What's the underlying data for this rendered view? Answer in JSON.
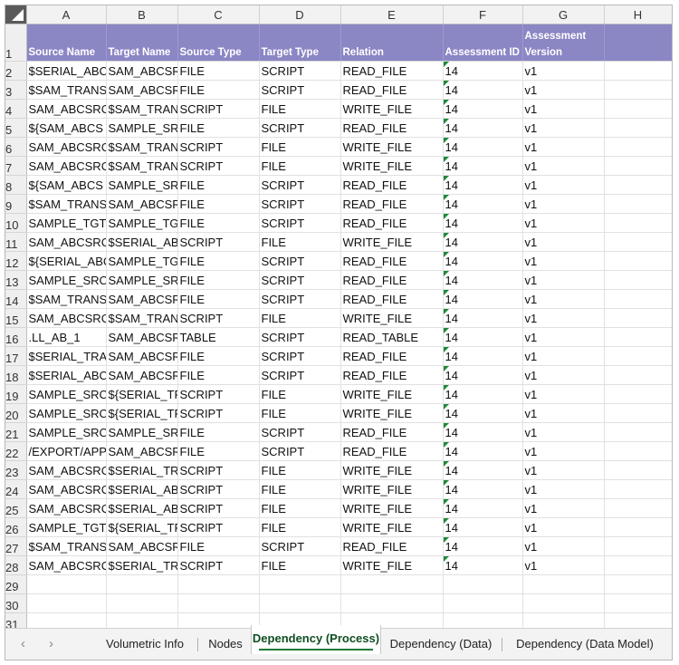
{
  "columns": [
    "A",
    "B",
    "C",
    "D",
    "E",
    "F",
    "G",
    "H"
  ],
  "header_row": {
    "number": "1",
    "cells": [
      "Source Name",
      "Target Name",
      "Source Type",
      "Target Type",
      "Relation",
      "Assessment ID",
      "Assessment Version",
      ""
    ]
  },
  "rows": [
    {
      "n": "2",
      "cells": [
        "$SERIAL_ABC",
        "SAM_ABCSR",
        "FILE",
        "SCRIPT",
        "READ_FILE",
        "14",
        "v1"
      ]
    },
    {
      "n": "3",
      "cells": [
        "$SAM_TRANS",
        "SAM_ABCSR",
        "FILE",
        "SCRIPT",
        "READ_FILE",
        "14",
        "v1"
      ]
    },
    {
      "n": "4",
      "cells": [
        "SAM_ABCSRC",
        "$SAM_TRAN",
        "SCRIPT",
        "FILE",
        "WRITE_FILE",
        "14",
        "v1"
      ]
    },
    {
      "n": "5",
      "cells": [
        "${SAM_ABCS",
        "SAMPLE_SR",
        "FILE",
        "SCRIPT",
        "READ_FILE",
        "14",
        "v1"
      ]
    },
    {
      "n": "6",
      "cells": [
        "SAM_ABCSRC",
        "$SAM_TRAN",
        "SCRIPT",
        "FILE",
        "WRITE_FILE",
        "14",
        "v1"
      ]
    },
    {
      "n": "7",
      "cells": [
        "SAM_ABCSRC",
        "$SAM_TRAN",
        "SCRIPT",
        "FILE",
        "WRITE_FILE",
        "14",
        "v1"
      ]
    },
    {
      "n": "8",
      "cells": [
        "${SAM_ABCS",
        "SAMPLE_SR",
        "FILE",
        "SCRIPT",
        "READ_FILE",
        "14",
        "v1"
      ]
    },
    {
      "n": "9",
      "cells": [
        "$SAM_TRANS",
        "SAM_ABCSR",
        "FILE",
        "SCRIPT",
        "READ_FILE",
        "14",
        "v1"
      ]
    },
    {
      "n": "10",
      "cells": [
        "SAMPLE_TGT_",
        "SAMPLE_TG",
        "FILE",
        "SCRIPT",
        "READ_FILE",
        "14",
        "v1"
      ]
    },
    {
      "n": "11",
      "cells": [
        "SAM_ABCSRC",
        "$SERIAL_AB",
        "SCRIPT",
        "FILE",
        "WRITE_FILE",
        "14",
        "v1"
      ]
    },
    {
      "n": "12",
      "cells": [
        "${SERIAL_ABC",
        "SAMPLE_TG",
        "FILE",
        "SCRIPT",
        "READ_FILE",
        "14",
        "v1"
      ]
    },
    {
      "n": "13",
      "cells": [
        "SAMPLE_SRC",
        "SAMPLE_SR",
        "FILE",
        "SCRIPT",
        "READ_FILE",
        "14",
        "v1"
      ]
    },
    {
      "n": "14",
      "cells": [
        "$SAM_TRANS",
        "SAM_ABCSR",
        "FILE",
        "SCRIPT",
        "READ_FILE",
        "14",
        "v1"
      ]
    },
    {
      "n": "15",
      "cells": [
        "SAM_ABCSRC",
        "$SAM_TRAN",
        "SCRIPT",
        "FILE",
        "WRITE_FILE",
        "14",
        "v1"
      ]
    },
    {
      "n": "16",
      "cells": [
        ".LL_AB_1",
        "SAM_ABCSR",
        "TABLE",
        "SCRIPT",
        "READ_TABLE",
        "14",
        "v1"
      ]
    },
    {
      "n": "17",
      "cells": [
        "$SERIAL_TRA",
        "SAM_ABCSR",
        "FILE",
        "SCRIPT",
        "READ_FILE",
        "14",
        "v1"
      ]
    },
    {
      "n": "18",
      "cells": [
        "$SERIAL_ABC",
        "SAM_ABCSR",
        "FILE",
        "SCRIPT",
        "READ_FILE",
        "14",
        "v1"
      ]
    },
    {
      "n": "19",
      "cells": [
        "SAMPLE_SRC",
        "${SERIAL_TR",
        "SCRIPT",
        "FILE",
        "WRITE_FILE",
        "14",
        "v1"
      ]
    },
    {
      "n": "20",
      "cells": [
        "SAMPLE_SRC",
        "${SERIAL_TR",
        "SCRIPT",
        "FILE",
        "WRITE_FILE",
        "14",
        "v1"
      ]
    },
    {
      "n": "21",
      "cells": [
        "SAMPLE_SRC",
        "SAMPLE_SR",
        "FILE",
        "SCRIPT",
        "READ_FILE",
        "14",
        "v1"
      ]
    },
    {
      "n": "22",
      "cells": [
        "/EXPORT/APP",
        "SAM_ABCSR",
        "FILE",
        "SCRIPT",
        "READ_FILE",
        "14",
        "v1"
      ]
    },
    {
      "n": "23",
      "cells": [
        "SAM_ABCSRC",
        "$SERIAL_TR",
        "SCRIPT",
        "FILE",
        "WRITE_FILE",
        "14",
        "v1"
      ]
    },
    {
      "n": "24",
      "cells": [
        "SAM_ABCSRC",
        "$SERIAL_AB",
        "SCRIPT",
        "FILE",
        "WRITE_FILE",
        "14",
        "v1"
      ]
    },
    {
      "n": "25",
      "cells": [
        "SAM_ABCSRC",
        "$SERIAL_AB",
        "SCRIPT",
        "FILE",
        "WRITE_FILE",
        "14",
        "v1"
      ]
    },
    {
      "n": "26",
      "cells": [
        "SAMPLE_TGT_",
        "${SERIAL_TR",
        "SCRIPT",
        "FILE",
        "WRITE_FILE",
        "14",
        "v1"
      ]
    },
    {
      "n": "27",
      "cells": [
        "$SAM_TRANS",
        "SAM_ABCSR",
        "FILE",
        "SCRIPT",
        "READ_FILE",
        "14",
        "v1"
      ]
    },
    {
      "n": "28",
      "cells": [
        "SAM_ABCSRC",
        "$SERIAL_TR",
        "SCRIPT",
        "FILE",
        "WRITE_FILE",
        "14",
        "v1"
      ]
    }
  ],
  "empty_rows": [
    "29",
    "30",
    "31"
  ],
  "sheet_tabs": [
    {
      "label": "Volumetric Info",
      "active": false
    },
    {
      "label": "Nodes",
      "active": false
    },
    {
      "label": "Dependency (Process)",
      "active": true
    },
    {
      "label": "Dependency (Data)",
      "active": false
    },
    {
      "label": "Dependency (Data Model)",
      "active": false
    }
  ],
  "colors": {
    "header_fill": "#8b86c4",
    "accent_green": "#1e7a35",
    "corner": "#5a5a5a"
  }
}
